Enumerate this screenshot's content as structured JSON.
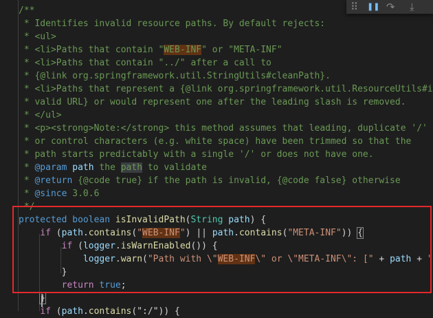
{
  "editor": {
    "colors": {
      "background": "#1e1e1e",
      "comment": "#6a9955",
      "keyword": "#569cd6",
      "control": "#c586c0",
      "type": "#4ec9b0",
      "function": "#dcdcaa",
      "variable": "#9cdcfe",
      "string": "#ce9178",
      "highlight": "#613214",
      "annotation_box": "#e5282b"
    },
    "lines": [
      [
        {
          "t": "/**",
          "c": "comment"
        }
      ],
      [
        {
          "t": " * Identifies invalid resource paths. By default rejects:",
          "c": "comment"
        }
      ],
      [
        {
          "t": " * ",
          "c": "comment"
        },
        {
          "t": "<ul>",
          "c": "comment"
        }
      ],
      [
        {
          "t": " * ",
          "c": "comment"
        },
        {
          "t": "<li>",
          "c": "comment"
        },
        {
          "t": "Paths that contain \"",
          "c": "comment"
        },
        {
          "t": "WEB-INF",
          "c": "comment",
          "h": "hl"
        },
        {
          "t": "\" or \"META-INF\"",
          "c": "comment"
        }
      ],
      [
        {
          "t": " * ",
          "c": "comment"
        },
        {
          "t": "<li>",
          "c": "comment"
        },
        {
          "t": "Paths that contain \"../\" after a call to",
          "c": "comment"
        }
      ],
      [
        {
          "t": " * {@link org.springframework.util.StringUtils#cleanPath}.",
          "c": "comment"
        }
      ],
      [
        {
          "t": " * ",
          "c": "comment"
        },
        {
          "t": "<li>",
          "c": "comment"
        },
        {
          "t": "Paths that represent a {@link org.springframework.util.ResourceUtils#isU",
          "c": "comment"
        }
      ],
      [
        {
          "t": " * valid URL} or would represent one after the leading slash is removed.",
          "c": "comment"
        }
      ],
      [
        {
          "t": " * ",
          "c": "comment"
        },
        {
          "t": "</ul>",
          "c": "comment"
        }
      ],
      [
        {
          "t": " * ",
          "c": "comment"
        },
        {
          "t": "<p><strong>",
          "c": "comment"
        },
        {
          "t": "Note:",
          "c": "comment"
        },
        {
          "t": "</strong>",
          "c": "comment"
        },
        {
          "t": " this method assumes that leading, duplicate '/'",
          "c": "comment"
        }
      ],
      [
        {
          "t": " * or control characters (e.g. white space) have been trimmed so that the",
          "c": "comment"
        }
      ],
      [
        {
          "t": " * path starts predictably with a single '/' or does not have one.",
          "c": "comment"
        }
      ],
      [
        {
          "t": " * ",
          "c": "comment"
        },
        {
          "t": "@param",
          "c": "keyword"
        },
        {
          "t": " ",
          "c": "comment"
        },
        {
          "t": "path",
          "c": "var"
        },
        {
          "t": " the ",
          "c": "comment"
        },
        {
          "t": "path",
          "c": "comment",
          "h": "hl-sym"
        },
        {
          "t": " to validate",
          "c": "comment"
        }
      ],
      [
        {
          "t": " * ",
          "c": "comment"
        },
        {
          "t": "@return",
          "c": "keyword"
        },
        {
          "t": " {@code true} if the path is invalid, {@code false} otherwise",
          "c": "comment"
        }
      ],
      [
        {
          "t": " * ",
          "c": "comment"
        },
        {
          "t": "@since",
          "c": "keyword"
        },
        {
          "t": " 3.0.6",
          "c": "comment"
        }
      ],
      [
        {
          "t": " */",
          "c": "comment"
        }
      ],
      [
        {
          "t": "protected",
          "c": "keyword"
        },
        {
          "t": " ",
          "c": "punct"
        },
        {
          "t": "boolean",
          "c": "keyword"
        },
        {
          "t": " ",
          "c": "punct"
        },
        {
          "t": "isInvalidPath",
          "c": "func"
        },
        {
          "t": "(",
          "c": "punct"
        },
        {
          "t": "String",
          "c": "type"
        },
        {
          "t": " ",
          "c": "punct"
        },
        {
          "t": "path",
          "c": "var"
        },
        {
          "t": ") {",
          "c": "punct"
        }
      ],
      [
        {
          "t": "    ",
          "c": "punct"
        },
        {
          "t": "if",
          "c": "control"
        },
        {
          "t": " (",
          "c": "punct"
        },
        {
          "t": "path",
          "c": "var"
        },
        {
          "t": ".",
          "c": "punct"
        },
        {
          "t": "contains",
          "c": "func"
        },
        {
          "t": "(",
          "c": "punct"
        },
        {
          "t": "\"",
          "c": "string"
        },
        {
          "t": "WEB-INF",
          "c": "string",
          "h": "hl"
        },
        {
          "t": "\"",
          "c": "string"
        },
        {
          "t": ") || ",
          "c": "punct"
        },
        {
          "t": "path",
          "c": "var"
        },
        {
          "t": ".",
          "c": "punct"
        },
        {
          "t": "contains",
          "c": "func"
        },
        {
          "t": "(",
          "c": "punct"
        },
        {
          "t": "\"META-INF\"",
          "c": "string"
        },
        {
          "t": ")) ",
          "c": "punct"
        },
        {
          "t": "{",
          "c": "punct",
          "h": "bracket-match"
        }
      ],
      [
        {
          "t": "        ",
          "c": "punct"
        },
        {
          "t": "if",
          "c": "control"
        },
        {
          "t": " (",
          "c": "punct"
        },
        {
          "t": "logger",
          "c": "var"
        },
        {
          "t": ".",
          "c": "punct"
        },
        {
          "t": "isWarnEnabled",
          "c": "func"
        },
        {
          "t": "()) {",
          "c": "punct"
        }
      ],
      [
        {
          "t": "            ",
          "c": "punct"
        },
        {
          "t": "logger",
          "c": "var"
        },
        {
          "t": ".",
          "c": "punct"
        },
        {
          "t": "warn",
          "c": "func"
        },
        {
          "t": "(",
          "c": "punct"
        },
        {
          "t": "\"Path with \\\"",
          "c": "string"
        },
        {
          "t": "WEB-INF",
          "c": "string",
          "h": "hl"
        },
        {
          "t": "\\\" or \\\"META-INF\\\": [\"",
          "c": "string"
        },
        {
          "t": " + ",
          "c": "punct"
        },
        {
          "t": "path",
          "c": "var"
        },
        {
          "t": " + ",
          "c": "punct"
        },
        {
          "t": "\"]\"",
          "c": "string"
        }
      ],
      [
        {
          "t": "        }",
          "c": "punct"
        }
      ],
      [
        {
          "t": "        ",
          "c": "punct"
        },
        {
          "t": "return",
          "c": "control"
        },
        {
          "t": " ",
          "c": "punct"
        },
        {
          "t": "true",
          "c": "keyword"
        },
        {
          "t": ";",
          "c": "punct"
        }
      ],
      [
        {
          "t": "    ",
          "c": "punct"
        },
        {
          "t": "}",
          "c": "punct",
          "h": "bracket-match"
        }
      ],
      [
        {
          "t": "    ",
          "c": "punct"
        },
        {
          "t": "if",
          "c": "control"
        },
        {
          "t": " (",
          "c": "punct"
        },
        {
          "t": "path",
          "c": "var"
        },
        {
          "t": ".",
          "c": "punct"
        },
        {
          "t": "contains",
          "c": "func"
        },
        {
          "t": "(\":/\")) {",
          "c": "punct"
        }
      ]
    ]
  },
  "debug_toolbar": {
    "items": [
      {
        "icon": "drag-handle-icon",
        "glyph": "⠿",
        "color": "#858585"
      },
      {
        "icon": "pause-icon",
        "glyph": "❚❚",
        "color": "#75beff"
      },
      {
        "icon": "step-over-icon",
        "glyph": "↷",
        "color": "#858585"
      },
      {
        "icon": "step-into-icon",
        "glyph": "⤓",
        "color": "#858585"
      }
    ]
  }
}
